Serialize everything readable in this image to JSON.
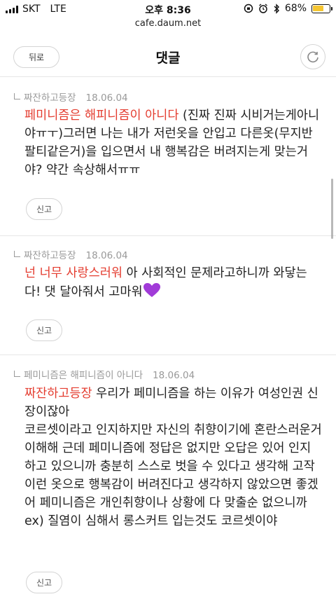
{
  "status": {
    "carrier": "SKT",
    "network": "LTE",
    "time": "오후 8:36",
    "battery": "68%",
    "battery_level": 0.68,
    "battery_color": "#f5c531"
  },
  "browser": {
    "url": "cafe.daum.net"
  },
  "header": {
    "back_label": "뒤로",
    "title": "댓글",
    "refresh_icon": "refresh-icon"
  },
  "comments": [
    {
      "author": "짜잔하고등장",
      "date": "18.06.04",
      "highlight": "페미니즘은 해피니즘이 아니다",
      "text": " (진짜 진짜 시비거는게아니야ㅠㅜ)그러면 나는 내가 저런옷을 안입고 다른옷(무지반팔티같은거)을 입으면서 내 행복감은 버려지는게 맞는거야? 약간 속상해서ㅠㅠ",
      "report_label": "신고"
    },
    {
      "author": "짜잔하고등장",
      "date": "18.06.04",
      "highlight": "넌 너무 사랑스러워",
      "text": " 아 사회적인 문제라고하니까 와닿는다! 댓 달아줘서 고마워",
      "emoji": "purple-heart",
      "report_label": "신고"
    },
    {
      "author": "페미니즘은 해피니즘이 아니다",
      "date": "18.06.04",
      "highlight": "짜잔하고등장",
      "text": " 우리가 페미니즘을 하는 이유가 여성인권 신장이잖아",
      "lines": [
        "코르셋이라고 인지하지만 자신의 취향이기에 혼란스러운거 이해해 근데 페미니즘에 정답은 없지만 오답은 있어 인지하고 있으니까 충분히 스스로 벗을 수 있다고 생각해 고작 이런 옷으로 행복감이 버려진다고 생각하지 않았으면 좋겠어 페미니즘은 개인취향이나 상황에 다 맞출순 없으니까",
        "ex) 질염이 심해서 롱스커트 입는것도 코르셋이야"
      ],
      "report_label": "신고"
    }
  ],
  "colors": {
    "accent": "#e43d30",
    "meta": "#999999"
  }
}
